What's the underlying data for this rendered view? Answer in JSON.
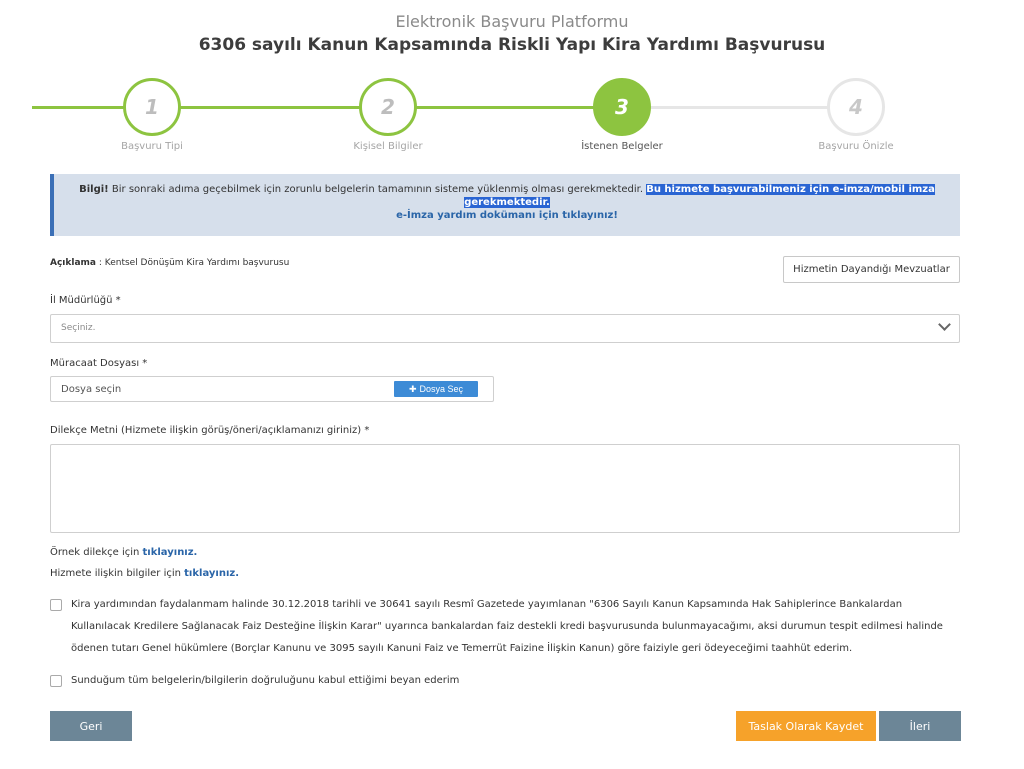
{
  "header": {
    "platform": "Elektronik Başvuru Platformu",
    "service_title": "6306 sayılı Kanun Kapsamında Riskli Yapı Kira Yardımı Başvurusu"
  },
  "steps": [
    {
      "number": "1",
      "label": "Başvuru Tipi",
      "state": "done"
    },
    {
      "number": "2",
      "label": "Kişisel Bilgiler",
      "state": "done"
    },
    {
      "number": "3",
      "label": "İstenen Belgeler",
      "state": "active"
    },
    {
      "number": "4",
      "label": "Başvuru Önizle",
      "state": "pending"
    }
  ],
  "colors": {
    "accent_green": "#8dc440",
    "primary_blue": "#3d8bd6",
    "button_grey": "#6c8697",
    "button_orange": "#f6a22a",
    "info_bg": "#d6dfeb"
  },
  "info": {
    "prefix": "Bilgi!",
    "text": " Bir sonraki adıma geçebilmek için zorunlu belgelerin tamamının sisteme yüklenmiş olması gerekmektedir. ",
    "highlight": "Bu hizmete başvurabilmeniz için e-imza/mobil imza gerekmektedir.",
    "link": "e-İmza yardım dokümanı için tıklayınız!"
  },
  "description": {
    "label": "Açıklama",
    "separator": " : ",
    "value": "Kentsel Dönüşüm Kira Yardımı başvurusu"
  },
  "regulations_button": "Hizmetin Dayandığı Mevzuatlar",
  "fields": {
    "province_label": "İl Müdürlüğü *",
    "province_value": "Seçiniz.",
    "file_label": "Müracaat Dosyası *",
    "file_placeholder": "Dosya seçin",
    "file_button": "Dosya Seç",
    "petition_label": "Dilekçe Metni (Hizmete ilişkin görüş/öneri/açıklamanızı giriniz) *",
    "petition_value": ""
  },
  "links": {
    "sample_prefix": "Örnek dilekçe için ",
    "sample_link": "tıklayınız.",
    "info_prefix": "Hizmete ilişkin bilgiler için ",
    "info_link": "tıklayınız."
  },
  "checks": {
    "commitment": "Kira yardımından faydalanmam halinde 30.12.2018 tarihli ve 30641 sayılı Resmî Gazetede yayımlanan \"6306 Sayılı Kanun Kapsamında Hak Sahiplerince Bankalardan Kullanılacak Kredilere Sağlanacak Faiz Desteğine İlişkin Karar\" uyarınca bankalardan faiz destekli kredi başvurusunda bulunmayacağımı, aksi durumun tespit edilmesi halinde ödenen tutarı Genel hükümlere (Borçlar Kanunu ve 3095 sayılı Kanuni Faiz ve Temerrüt Faizine İlişkin Kanun) göre faiziyle geri ödeyeceğimi taahhüt ederim.",
    "declaration": "Sunduğum tüm belgelerin/bilgilerin doğruluğunu kabul ettiğimi beyan ederim"
  },
  "buttons": {
    "back": "Geri",
    "draft": "Taslak Olarak Kaydet",
    "next": "İleri"
  }
}
